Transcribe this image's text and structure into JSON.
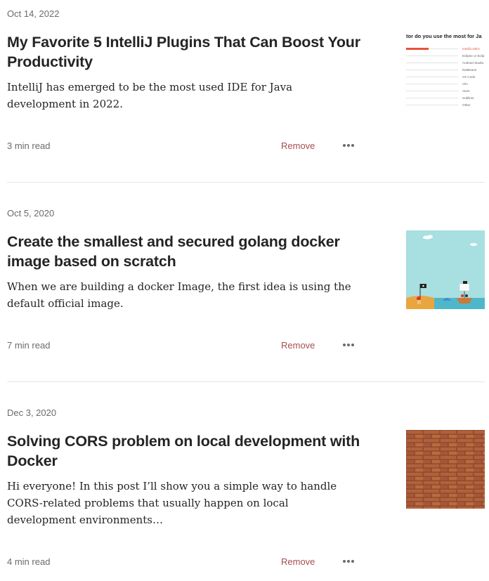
{
  "articles": [
    {
      "date": "Oct 14, 2022",
      "title": "My Favorite 5 IntelliJ Plugins That Can Boost Your Productivity",
      "excerpt": "IntelliJ has emerged to be the most used IDE for Java development in 2022.",
      "read_time": "3 min read",
      "remove_label": "Remove",
      "thumbnail": {
        "type": "survey-chart",
        "heading": "tor do you use the most for Ja",
        "options": [
          "IntelliJ IDEA",
          "Eclipse or Eclip",
          "Android Studio",
          "NetBeans",
          "VS Code",
          "Vim",
          "Atom",
          "Sublime",
          "Other"
        ],
        "accent": "#e8503a"
      }
    },
    {
      "date": "Oct 5, 2020",
      "title": "Create the smallest and secured golang docker image based on scratch",
      "excerpt": "When we are building a docker Image, the first idea is using the default official image.",
      "read_time": "7 min read",
      "remove_label": "Remove",
      "thumbnail": {
        "type": "pirate-illustration",
        "sky": "#a8dfe0",
        "sea": "#4fb7c9",
        "sand": "#e9a640"
      }
    },
    {
      "date": "Dec 3, 2020",
      "title": "Solving CORS problem on local development with Docker",
      "excerpt": "Hi everyone! In this post I’ll show you a simple way to handle CORS-related problems that usually happen on local development environments…",
      "read_time": "4 min read",
      "remove_label": "Remove",
      "thumbnail": {
        "type": "brick-wall",
        "brick": "#b2613a",
        "mortar": "#8a4a2d"
      }
    }
  ],
  "colors": {
    "meta": "#6b6b6b",
    "remove": "#a64d4d",
    "divider": "#e6e6e6"
  },
  "icons": {
    "more": "more-horizontal-icon"
  }
}
